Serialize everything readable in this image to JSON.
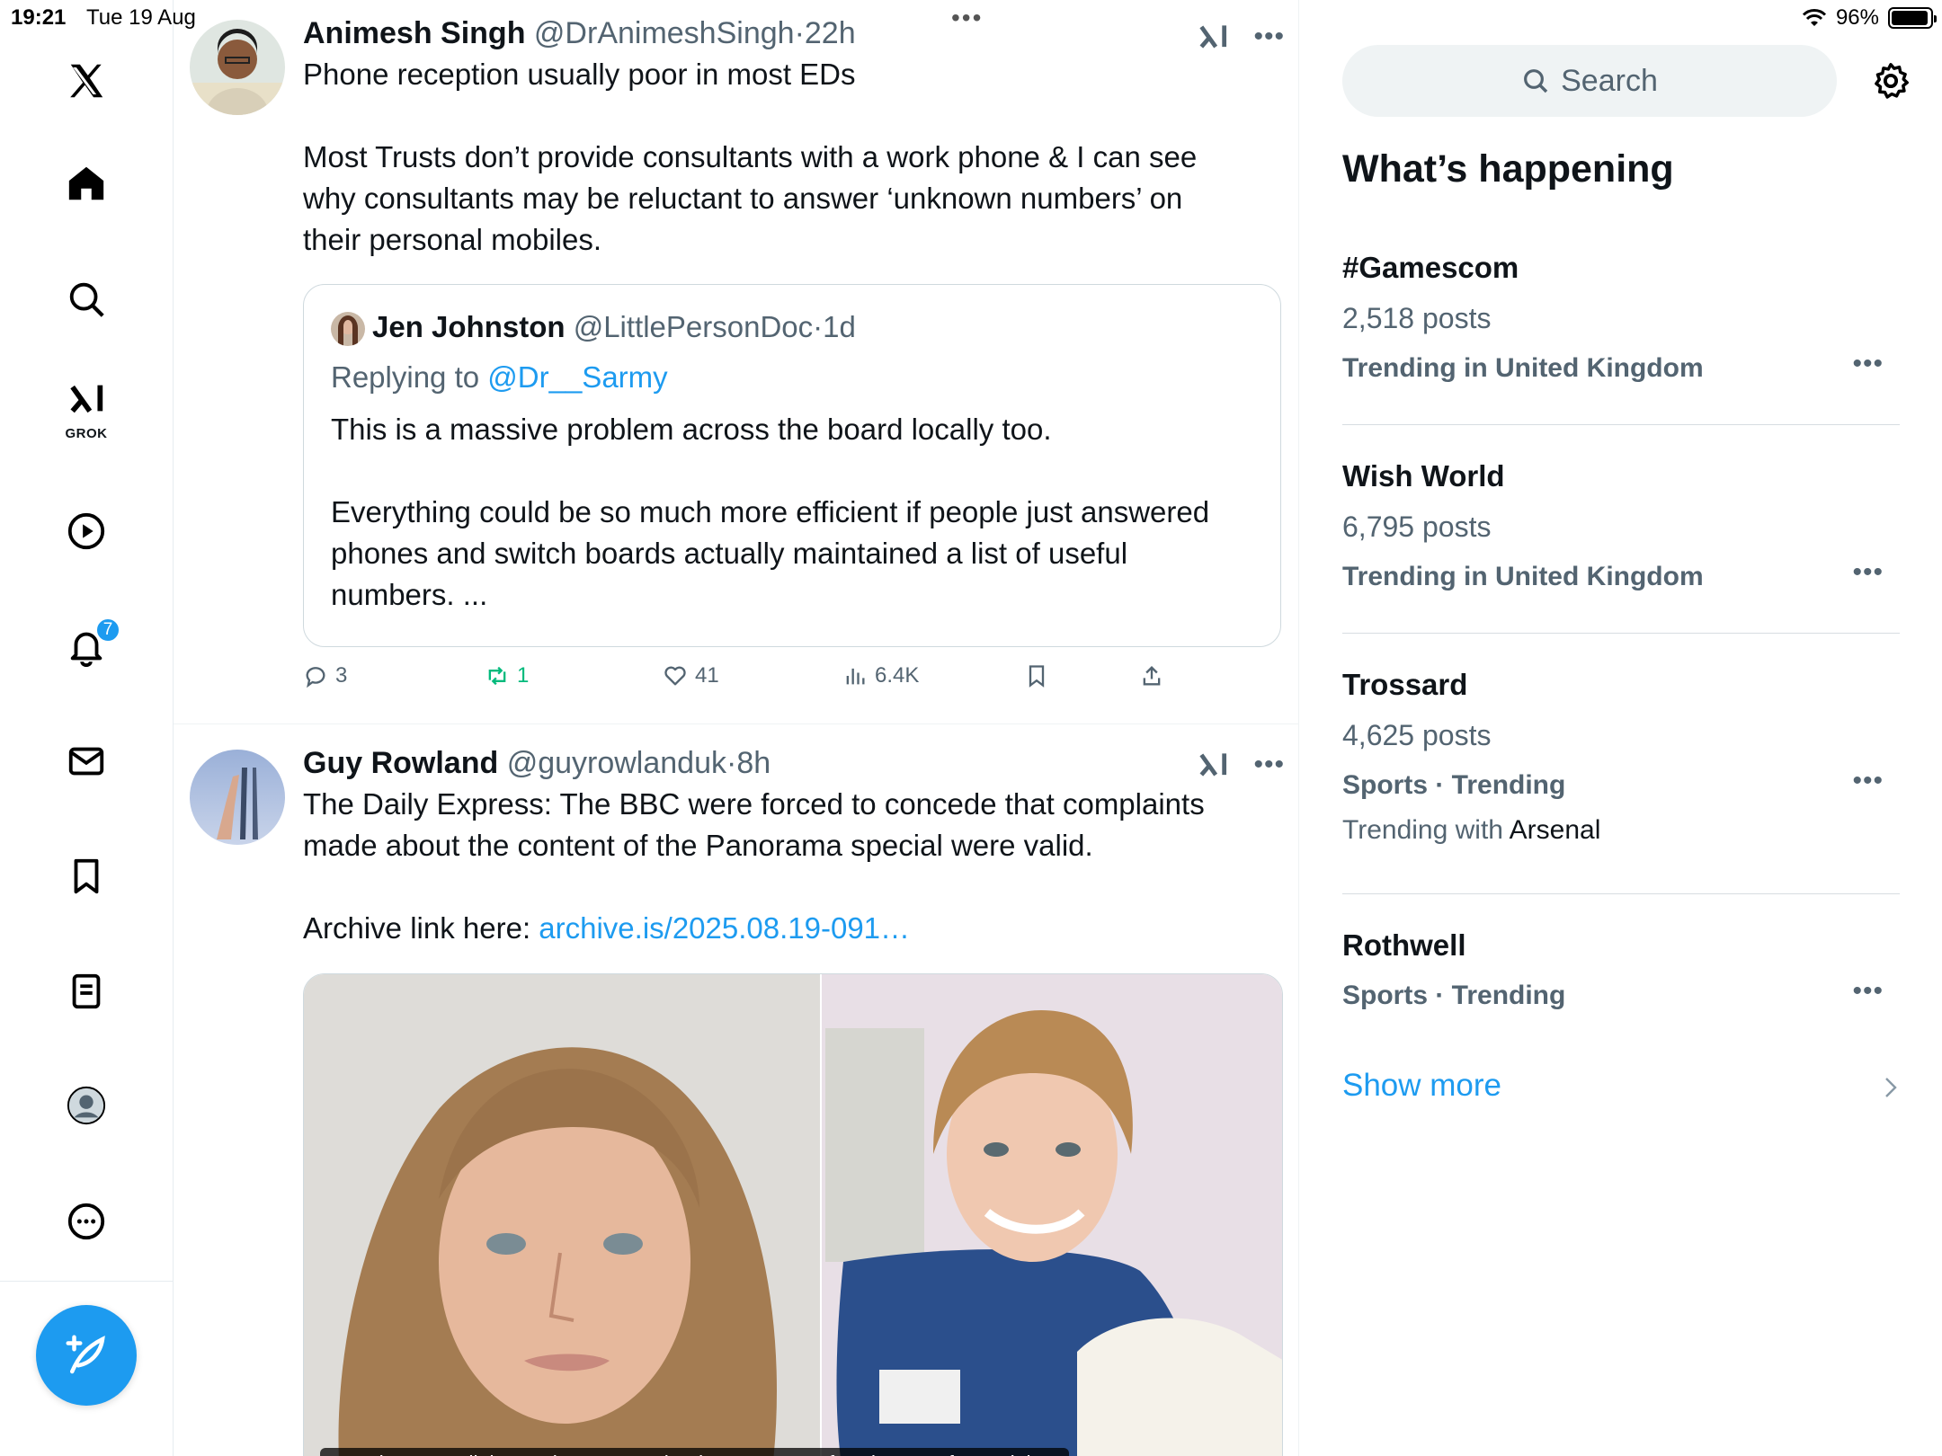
{
  "status_bar": {
    "time": "19:21",
    "date": "Tue 19 Aug",
    "battery": "96%",
    "battery_level": 0.96
  },
  "nav": {
    "grok_label": "GROK",
    "notifications_badge": "7"
  },
  "tweets": [
    {
      "name": "Animesh Singh",
      "handle": "@DrAnimeshSingh",
      "time": "22h",
      "lines": [
        "Phone reception usually poor in most EDs",
        "Most Trusts don’t provide consultants with a work phone & I can see",
        "why consultants may be reluctant to answer ‘unknown numbers’ on",
        "their personal mobiles."
      ],
      "quote": {
        "name": "Jen Johnston",
        "handle": "@LittlePersonDoc",
        "time": "1d",
        "replying_prefix": "Replying to",
        "replying_to": "@Dr__Sarmy",
        "lines": [
          "This is a massive problem across the board locally too.",
          "Everything could be so much more efficient if people just answered",
          "phones and switch boards actually maintained a list of useful",
          "numbers. ..."
        ]
      },
      "stats": {
        "replies": "3",
        "reposts": "1",
        "likes": "41",
        "views": "6.4K"
      }
    },
    {
      "name": "Guy Rowland",
      "handle": "@guyrowlanduk",
      "time": "8h",
      "lines": [
        "The Daily Express: The BBC were forced to concede that complaints",
        "made about the content of the Panorama special were valid."
      ],
      "archive_prefix": "Archive link here:",
      "archive_link": "archive.is/2025.08.19-091…",
      "media_caption": "BBC bosses edit harrowing Lucy Letby documentary after dozens of complaints"
    }
  ],
  "sidebar": {
    "search_placeholder": "Search",
    "title": "What’s happening",
    "trends": [
      {
        "name": "#Gamescom",
        "posts": "2,518 posts",
        "context": "Trending in United Kingdom"
      },
      {
        "name": "Wish World",
        "posts": "6,795 posts",
        "context": "Trending in United Kingdom"
      },
      {
        "name": "Trossard",
        "posts": "4,625 posts",
        "context": "Sports · Trending",
        "with_prefix": "Trending with",
        "with_term": "Arsenal"
      },
      {
        "name": "Rothwell",
        "context": "Sports · Trending"
      }
    ],
    "show_more": "Show more"
  },
  "colors": {
    "accent": "#1d9bf0",
    "repost_green": "#00ba7c",
    "muted": "#536471"
  }
}
